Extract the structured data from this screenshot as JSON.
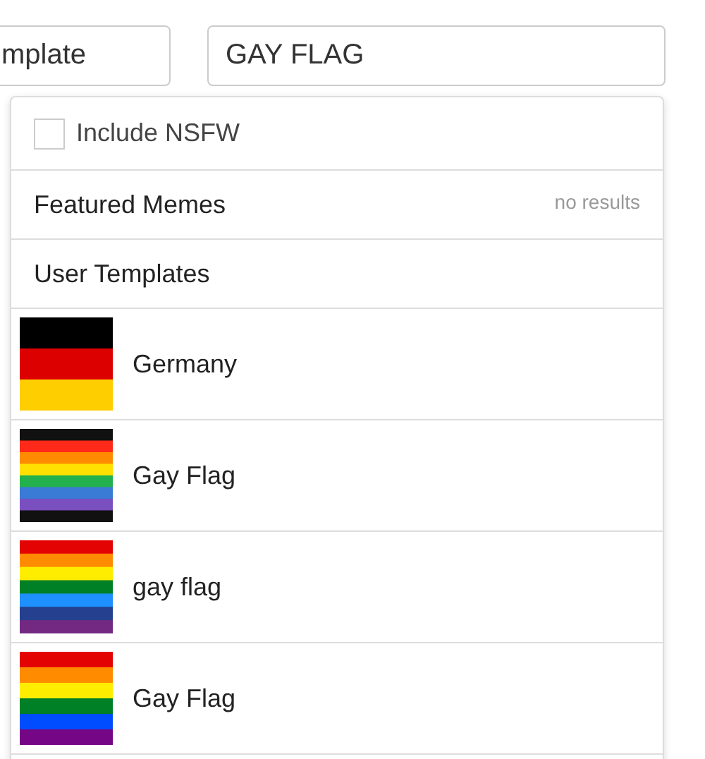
{
  "fields": [
    {
      "value": "mplate"
    },
    {
      "value": "GAY FLAG"
    }
  ],
  "dropdown": {
    "nsfw": {
      "label": "Include NSFW",
      "checked": false
    },
    "sections": [
      {
        "title": "Featured Memes",
        "note": "no results"
      },
      {
        "title": "User Templates"
      }
    ],
    "results": [
      {
        "name": "Germany",
        "kind": "picture"
      },
      {
        "name": "Gay Flag",
        "kind": "picture"
      },
      {
        "name": "gay flag",
        "kind": "picture"
      },
      {
        "name": "Gay Flag",
        "kind": "picture"
      }
    ]
  }
}
